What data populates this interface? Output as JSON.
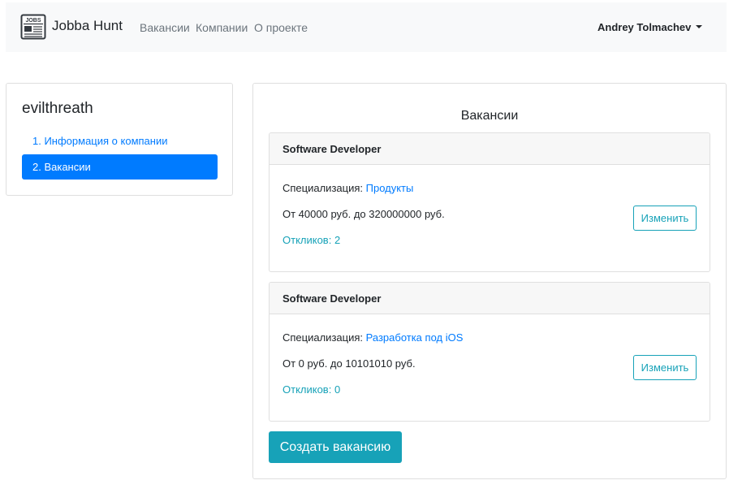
{
  "navbar": {
    "brand": "Jobba Hunt",
    "logo_text": "JOBS",
    "links": [
      "Вакансии",
      "Компании",
      "О проекте"
    ],
    "user": "Andrey Tolmachev"
  },
  "sidebar": {
    "company_name": "evilthreath",
    "items": [
      {
        "label": "1. Информация о компании",
        "active": false
      },
      {
        "label": "2. Вакансии",
        "active": true
      }
    ]
  },
  "main": {
    "title": "Вакансии",
    "spec_label": "Специализация:",
    "edit_label": "Изменить",
    "vacancies": [
      {
        "title": "Software Developer",
        "specialization": "Продукты",
        "salary": "От 40000 руб. до 320000000 руб.",
        "responses": "Откликов: 2"
      },
      {
        "title": "Software Developer",
        "specialization": "Разработка под iOS",
        "salary": "От 0 руб. до 10101010 руб.",
        "responses": "Откликов: 0"
      }
    ],
    "create_button": "Создать вакансию"
  },
  "colors": {
    "primary": "#007bff",
    "info": "#17a2b8",
    "navbar_bg": "#f8f9fa"
  }
}
